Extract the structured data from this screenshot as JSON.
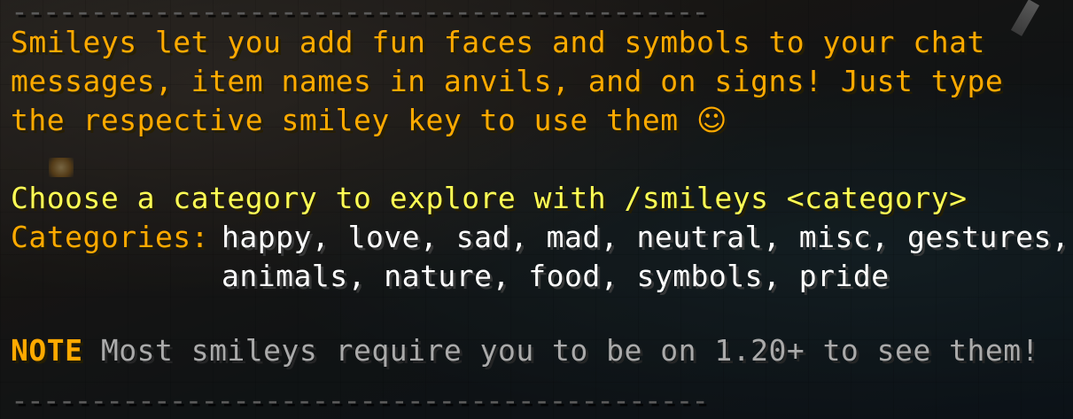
{
  "separator": "--------------------------------------------",
  "intro": {
    "line1": "Smileys let you add fun faces and symbols to your chat",
    "line2": "messages, item names in anvils, and on signs! Just type",
    "line3": "the respective smiley key to use them",
    "smiley": "☺"
  },
  "prompt": "Choose a category to explore with /smileys <category>",
  "categories": {
    "label": "Categories:",
    "line1": "happy, love, sad, mad, neutral, misc, gestures,",
    "line2": "animals, nature, food, symbols, pride"
  },
  "note": {
    "label": "NOTE",
    "text": "Most smileys require you to be on 1.20+ to see them!"
  },
  "colors": {
    "gold": "#FFAA00",
    "yellow": "#FFFF55",
    "white": "#FFFFFF",
    "gray": "#AAAAAA"
  }
}
